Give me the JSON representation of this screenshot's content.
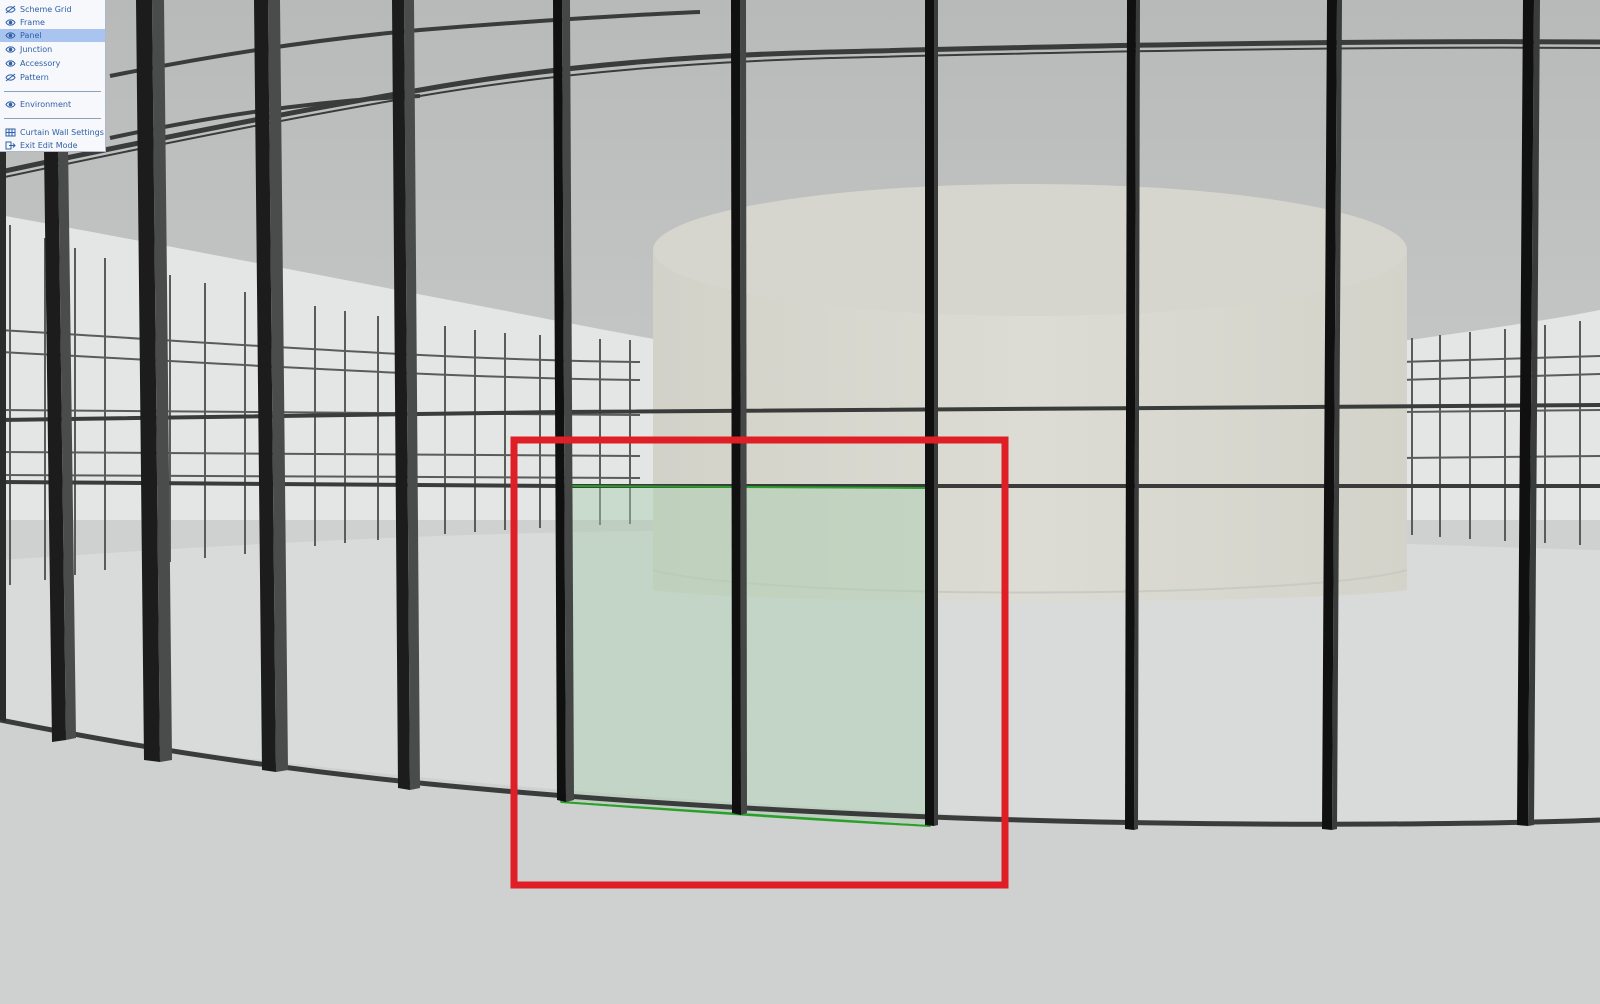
{
  "menu": {
    "items": [
      {
        "label": "Scheme Grid",
        "icon": "scheme-grid-hidden-icon",
        "selected": false
      },
      {
        "label": "Frame",
        "icon": "eye-icon",
        "selected": false
      },
      {
        "label": "Panel",
        "icon": "eye-icon",
        "selected": true
      },
      {
        "label": "Junction",
        "icon": "eye-icon",
        "selected": false
      },
      {
        "label": "Accessory",
        "icon": "eye-icon",
        "selected": false
      },
      {
        "label": "Pattern",
        "icon": "pattern-hidden-icon",
        "selected": false
      }
    ],
    "environment": {
      "label": "Environment",
      "icon": "eye-icon"
    },
    "actions": [
      {
        "label": "Curtain Wall Settings",
        "icon": "curtain-wall-settings-icon"
      },
      {
        "label": "Exit Edit Mode",
        "icon": "exit-edit-mode-icon"
      }
    ]
  },
  "colors": {
    "menu_text": "#2f5fa8",
    "menu_selected_bg": "#a9c4ef",
    "highlight_rect": "#e01e26",
    "selected_panel": "#2aa02a",
    "frame_mullion": "#1c1c1c"
  }
}
